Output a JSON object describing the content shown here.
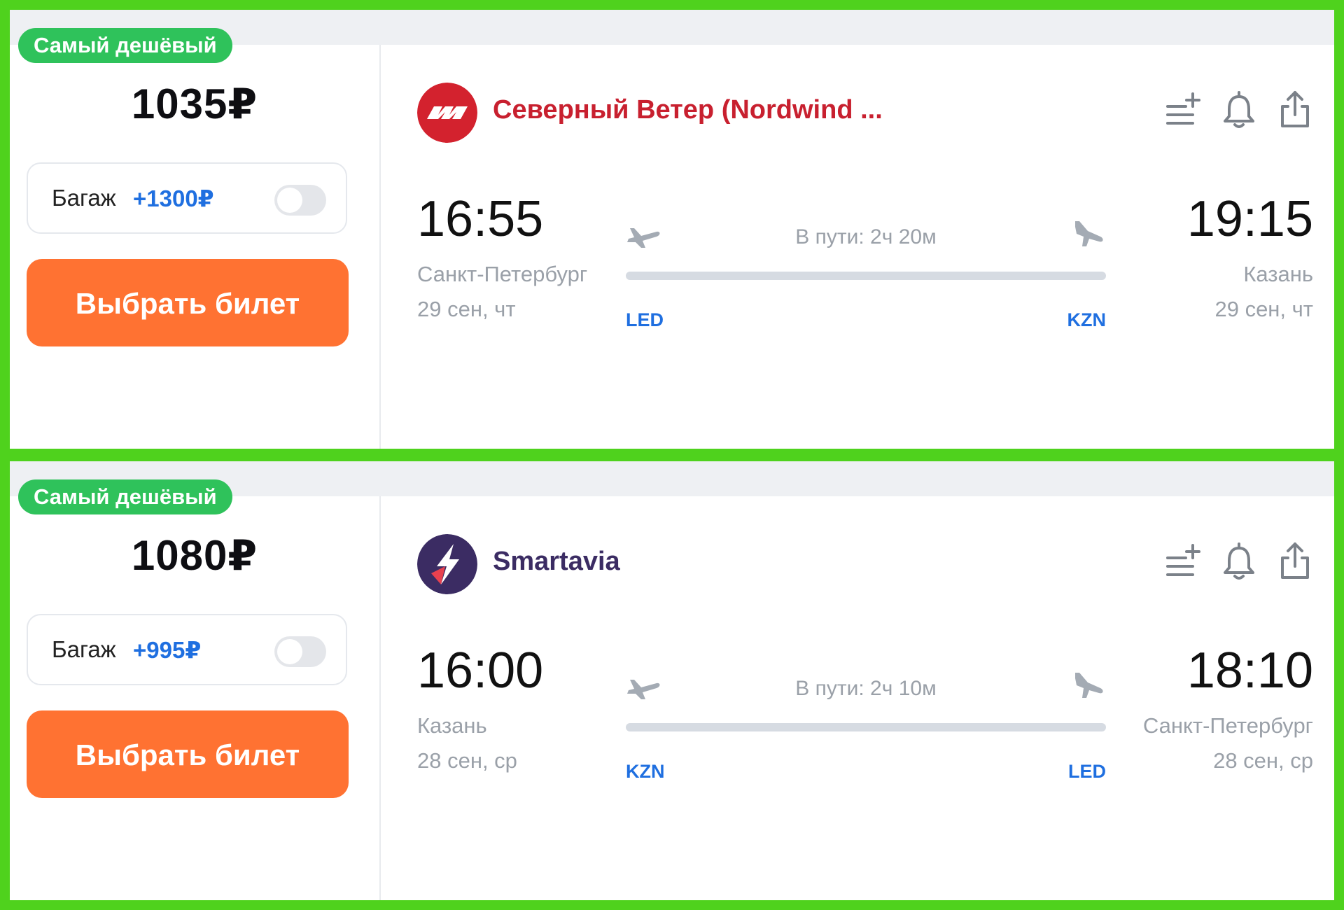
{
  "offers": [
    {
      "badge": "Самый дешёвый",
      "price": "1035₽",
      "baggage_label": "Багаж",
      "baggage_price": "+1300₽",
      "buy_label": "Выбрать билет",
      "airline": "Северный Ветер (Nordwind ...",
      "airline_color": "#c8202f",
      "logo": "nordwind-logo",
      "dep_time": "16:55",
      "arr_time": "19:15",
      "dep_city": "Санкт-Петербург",
      "arr_city": "Казань",
      "dep_date": "29 сен, чт",
      "arr_date": "29 сен, чт",
      "duration": "В пути: 2ч 20м",
      "dep_code": "LED",
      "arr_code": "KZN"
    },
    {
      "badge": "Самый дешёвый",
      "price": "1080₽",
      "baggage_label": "Багаж",
      "baggage_price": "+995₽",
      "buy_label": "Выбрать билет",
      "airline": "Smartavia",
      "airline_color": "#3b2c63",
      "logo": "smartavia-logo",
      "dep_time": "16:00",
      "arr_time": "18:10",
      "dep_city": "Казань",
      "arr_city": "Санкт-Петербург",
      "dep_date": "28 сен, ср",
      "arr_date": "28 сен, ср",
      "duration": "В пути: 2ч 10м",
      "dep_code": "KZN",
      "arr_code": "LED"
    }
  ],
  "colors": {
    "frame": "#4fd21d",
    "badge": "#2fc25b",
    "button": "#ff7232",
    "accent_blue": "#1f6fe0"
  },
  "icons": [
    "add-to-list-icon",
    "bell-icon",
    "share-icon",
    "takeoff-plane-icon",
    "landing-plane-icon"
  ]
}
